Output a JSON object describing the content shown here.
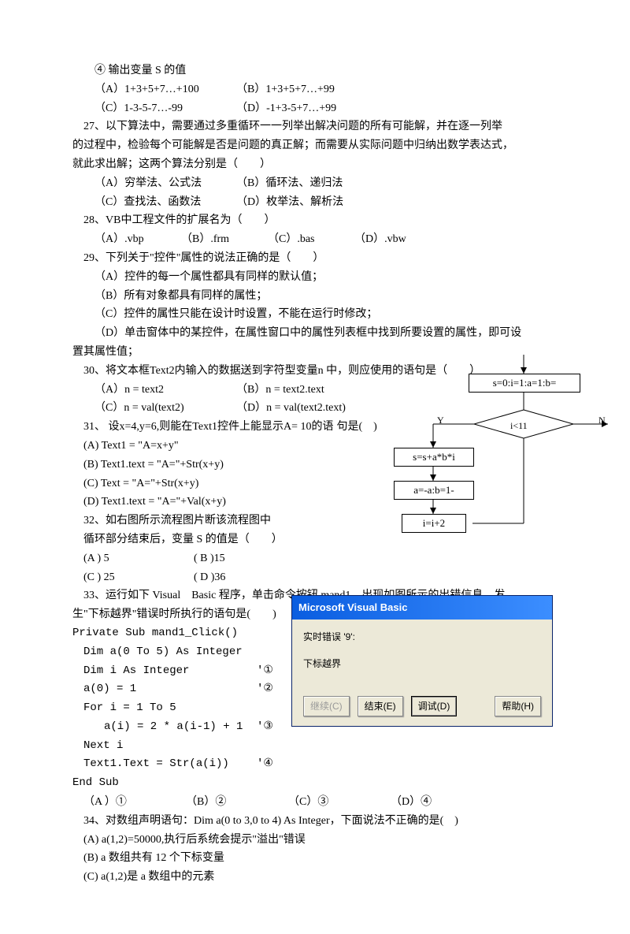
{
  "line_output_s": "④ 输出变量 S 的值",
  "q26": {
    "a": "（A）1+3+5+7…+100",
    "b": "（B）1+3+5+7…+99",
    "c": "（C）1-3-5-7…-99",
    "d": "（D）-1+3-5+7…+99"
  },
  "q27": {
    "text1": "27、以下算法中，需要通过多重循环一一列举出解决问题的所有可能解，并在逐一列举",
    "text2": "的过程中，检验每个可能解是否是问题的真正解；而需要从实际问题中归纳出数学表达式，",
    "text3": "就此求出解；这两个算法分别是（　　）",
    "a": "（A）穷举法、公式法",
    "b": "（B）循环法、递归法",
    "c": "（C）查找法、函数法",
    "d": "（D）枚举法、解析法"
  },
  "q28": {
    "text": "28、VB中工程文件的扩展名为（　　）",
    "a": "（A）.vbp",
    "b": "（B）.frm",
    "c": "（C）.bas",
    "d": "（D）.vbw"
  },
  "q29": {
    "text": "29、下列关于\"控件\"属性的说法正确的是（　　）",
    "a": "（A）控件的每一个属性都具有同样的默认值；",
    "b": "（B）所有对象都具有同样的属性；",
    "c": "（C）控件的属性只能在设计时设置，不能在运行时修改；",
    "d1": "（D）单击窗体中的某控件，在属性窗口中的属性列表框中找到所要设置的属性，即可设",
    "d2": "置其属性值；"
  },
  "q30": {
    "text": "30、将文本框Text2内输入的数据送到字符型变量n 中，则应使用的语句是（　　）",
    "a": "（A）n = text2",
    "b": "（B）n = text2.text",
    "c": "（C）n = val(text2)",
    "d": "（D）n = val(text2.text)"
  },
  "q31": {
    "text": "31、 设x=4,y=6,则能在Text1控件上能显示A= 10的语",
    "textend": "句是(　)",
    "a": "(A) Text1 = \"A=x+y\"",
    "b": "(B) Text1.text = \"A=\"+Str(x+y)",
    "c": "(C) Text = \"A=\"+Str(x+y)",
    "d": "(D) Text1.text = \"A=\"+Val(x+y)"
  },
  "q32": {
    "text1": "32、如右图所示流程图片断该流程图中",
    "text2": "循环部分结束后，变量 S 的值是（　　）",
    "a": "(A ) 5",
    "b": "( B )15",
    "c": "(C ) 25",
    "d": "( D )36"
  },
  "q33": {
    "text1": "33、运行如下 Visual　Basic 程序，单击命令按钮 mand1，出现如图所示的出错信息。发",
    "text2": "生\"下标越界\"错误时所执行的语句是(　　)",
    "code": {
      "l1": "Private Sub mand1_Click()",
      "l2": "Dim a(0 To 5) As Integer",
      "l3": "Dim i As Integer",
      "l3n": "'①",
      "l4": "a(0) = 1",
      "l4n": "'②",
      "l5": "For i = 1 To 5",
      "l6": "a(i) = 2 * a(i-1) + 1",
      "l6n": "'③",
      "l7": "Next i",
      "l8": "Text1.Text = Str(a(i))",
      "l8n": "'④",
      "l9": "End Sub"
    },
    "a": "（A ）①",
    "b": "（B）②",
    "c": "（C）③",
    "d": "（D）④"
  },
  "q34": {
    "text": "34、对数组声明语句：Dim a(0 to 3,0 to 4) As Integer，下面说法不正确的是(　)",
    "a": "(A) a(1,2)=50000,执行后系统会提示\"溢出\"错误",
    "b": "(B) a 数组共有 12 个下标变量",
    "c": "(C) a(1,2)是 a 数组中的元素"
  },
  "flowchart": {
    "init": "s=0:i=1:a=1:b=",
    "cond": "i<11",
    "step1": "s=s+a*b*i",
    "step2": "a=-a:b=1-",
    "step3": "i=i+2",
    "yes": "Y",
    "no": "N"
  },
  "dialog": {
    "title": "Microsoft Visual Basic",
    "err": "实时错误 '9':",
    "msg": "下标越界",
    "btn1": "继续(C)",
    "btn2": "结束(E)",
    "btn3": "调试(D)",
    "btn4": "帮助(H)"
  }
}
